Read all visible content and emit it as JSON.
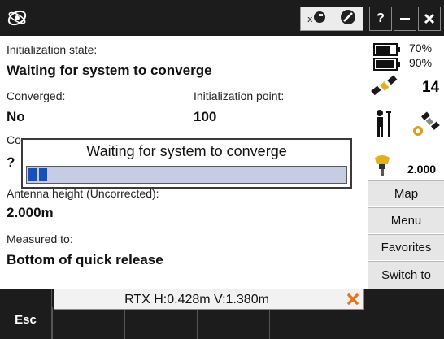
{
  "titlebar": {
    "logo_icon": "trimble-globe-icon",
    "status_icons": [
      "rtx-satellite-icon",
      "no-entry-icon"
    ],
    "help_label": "?",
    "minimize_label": "—",
    "close_label": "✕"
  },
  "main": {
    "init_state_label": "Initialization state:",
    "init_state_value": "Waiting for system to converge",
    "converged_label": "Converged:",
    "converged_value": "No",
    "init_point_label": "Initialization point:",
    "init_point_value": "100",
    "hidden_label_fragment": "Co",
    "hidden_value_fragment": "?",
    "antenna_label": "Antenna height (Uncorrected):",
    "antenna_value": "2.000m",
    "measured_label": "Measured to:",
    "measured_value": "Bottom of quick release"
  },
  "dialog": {
    "title": "Waiting for system to converge",
    "progress_segments": 2
  },
  "status_panel": {
    "battery_1": "70%",
    "battery_2": "90%",
    "satellite_count": "14",
    "antenna_height": "2.000"
  },
  "softkeys": {
    "map": "Map",
    "menu": "Menu",
    "favorites": "Favorites",
    "switch_to": "Switch to"
  },
  "bottombar": {
    "esc_label": "Esc",
    "rtx_text": "RTX H:0.428m V:1.380m"
  },
  "colors": {
    "titlebar_bg": "#1c1c1c",
    "progress_bg": "#c6cce4",
    "progress_fill": "#1a4eb8",
    "close_accent": "#e8731a"
  }
}
